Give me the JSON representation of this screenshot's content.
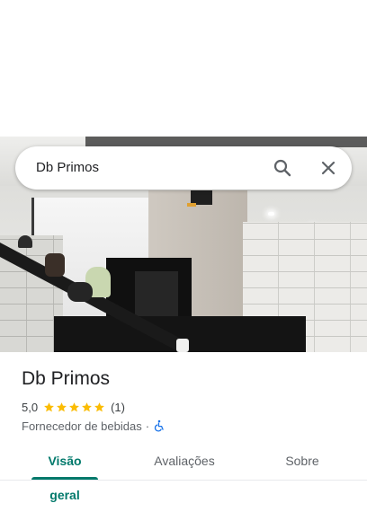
{
  "search": {
    "query": "Db Primos"
  },
  "icons": {
    "search": "search-icon",
    "close": "close-icon",
    "star": "star-icon",
    "accessibility": "wheelchair-accessible-icon"
  },
  "colors": {
    "accent": "#00796b",
    "star": "#fbbc04",
    "accessibility": "#1a73e8"
  },
  "place": {
    "name": "Db Primos",
    "rating": "5,0",
    "stars": 5,
    "review_count": "(1)",
    "category": "Fornecedor de bebidas",
    "separator": "·"
  },
  "tabs": [
    {
      "label": "Visão geral",
      "active": true
    },
    {
      "label": "Avaliações",
      "active": false
    },
    {
      "label": "Sobre",
      "active": false
    }
  ]
}
